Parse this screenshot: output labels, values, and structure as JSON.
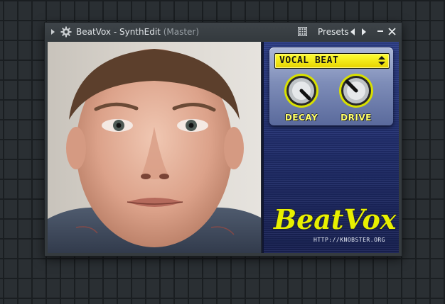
{
  "window": {
    "title": "BeatVox - SynthEdit",
    "title_context": "(Master)",
    "presets_label": "Presets"
  },
  "icons": {
    "expand": "triangle-right-icon",
    "gear": "gear-icon",
    "grid": "grid-icon",
    "prev": "arrow-left-icon",
    "next": "arrow-right-icon",
    "minimize": "minimize-icon",
    "close": "close-icon"
  },
  "plugin": {
    "preset_selected": "VOCAL BEAT",
    "knobs": [
      {
        "label": "DECAY"
      },
      {
        "label": "DRIVE"
      }
    ],
    "brand": "BeatVox",
    "url": "HTTP://KNOBSTER.ORG"
  },
  "colors": {
    "accent_yellow": "#ffff33",
    "panel_blue": "#25337a",
    "window_bg": "#353b3f"
  }
}
